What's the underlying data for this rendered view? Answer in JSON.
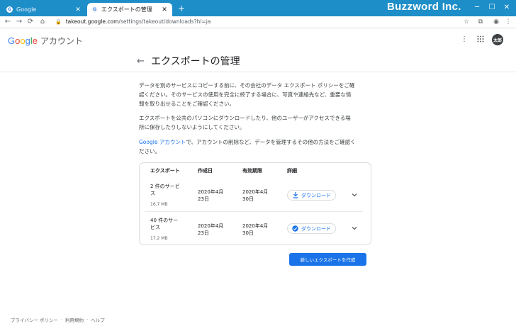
{
  "browser": {
    "tabs": [
      {
        "label": "Google",
        "favicon": "G",
        "close": "✕",
        "active": false
      },
      {
        "label": "エクスポートの管理",
        "favicon": "G",
        "close": "✕",
        "active": true
      }
    ],
    "new_tab": "+",
    "brand": "Buzzword Inc.",
    "url_host": "takeout.google.com",
    "url_path": "/settings/takeout/downloads?hl=ja"
  },
  "header": {
    "logo_letters": [
      "G",
      "o",
      "o",
      "g",
      "l",
      "e"
    ],
    "logo_suffix": "アカウント",
    "avatar_text": "太郎"
  },
  "main": {
    "title": "エクスポートの管理",
    "para1": [
      "データを別のサービスにコピーする前に、その会社のデータ エクスポート ポリシーをご確",
      "認ください。そのサービスの使用を完全に終了する場合に、写真や連絡先など、重要な情",
      "報を取り出せることをご確認ください。"
    ],
    "para2": [
      "エクスポートを公共のパソコンにダウンロードしたり、他のユーザーがアクセスできる場",
      "所に保存したりしないようにしてください。"
    ],
    "para3_link": "Google アカウント",
    "para3_rest": "で、アカウントの削除など、データを管理するその他の方法をご確認く",
    "para3_line2": "ださい。"
  },
  "table": {
    "headers": [
      "エクスポート",
      "作成日",
      "有効期限",
      "詳細"
    ],
    "rows": [
      {
        "name_l1": "2 件のサービ",
        "name_l2": "ス",
        "size": "16.7 MB",
        "created_l1": "2020年4月",
        "created_l2": "23日",
        "expires_l1": "2020年4月",
        "expires_l2": "30日",
        "action": "ダウンロード"
      },
      {
        "name_l1": "40 件のサー",
        "name_l2": "ビス",
        "size": "17.2 MB",
        "created_l1": "2020年4月",
        "created_l2": "23日",
        "expires_l1": "2020年4月",
        "expires_l2": "30日",
        "action": "ダウンロード"
      }
    ]
  },
  "actions": {
    "create_label": "新しいエクスポートを作成"
  },
  "footer": {
    "links": [
      "プライバシー ポリシー",
      "利用規約",
      "ヘルプ"
    ],
    "separator": "·"
  },
  "colors": {
    "titlebar": "#1e8ec8",
    "accent": "#1a73e8"
  }
}
